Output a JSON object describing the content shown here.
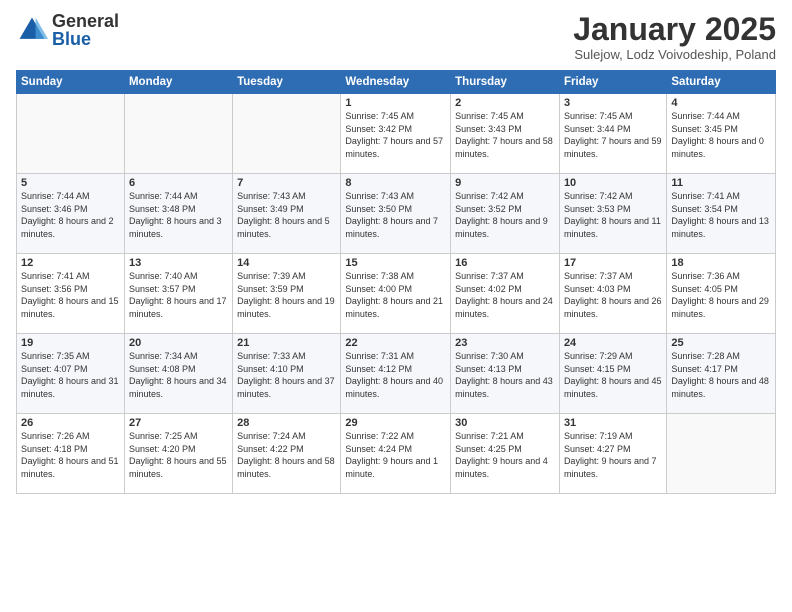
{
  "header": {
    "logo_general": "General",
    "logo_blue": "Blue",
    "month_title": "January 2025",
    "subtitle": "Sulejow, Lodz Voivodeship, Poland"
  },
  "weekdays": [
    "Sunday",
    "Monday",
    "Tuesday",
    "Wednesday",
    "Thursday",
    "Friday",
    "Saturday"
  ],
  "weeks": [
    [
      {
        "day": "",
        "info": ""
      },
      {
        "day": "",
        "info": ""
      },
      {
        "day": "",
        "info": ""
      },
      {
        "day": "1",
        "info": "Sunrise: 7:45 AM\nSunset: 3:42 PM\nDaylight: 7 hours and 57 minutes."
      },
      {
        "day": "2",
        "info": "Sunrise: 7:45 AM\nSunset: 3:43 PM\nDaylight: 7 hours and 58 minutes."
      },
      {
        "day": "3",
        "info": "Sunrise: 7:45 AM\nSunset: 3:44 PM\nDaylight: 7 hours and 59 minutes."
      },
      {
        "day": "4",
        "info": "Sunrise: 7:44 AM\nSunset: 3:45 PM\nDaylight: 8 hours and 0 minutes."
      }
    ],
    [
      {
        "day": "5",
        "info": "Sunrise: 7:44 AM\nSunset: 3:46 PM\nDaylight: 8 hours and 2 minutes."
      },
      {
        "day": "6",
        "info": "Sunrise: 7:44 AM\nSunset: 3:48 PM\nDaylight: 8 hours and 3 minutes."
      },
      {
        "day": "7",
        "info": "Sunrise: 7:43 AM\nSunset: 3:49 PM\nDaylight: 8 hours and 5 minutes."
      },
      {
        "day": "8",
        "info": "Sunrise: 7:43 AM\nSunset: 3:50 PM\nDaylight: 8 hours and 7 minutes."
      },
      {
        "day": "9",
        "info": "Sunrise: 7:42 AM\nSunset: 3:52 PM\nDaylight: 8 hours and 9 minutes."
      },
      {
        "day": "10",
        "info": "Sunrise: 7:42 AM\nSunset: 3:53 PM\nDaylight: 8 hours and 11 minutes."
      },
      {
        "day": "11",
        "info": "Sunrise: 7:41 AM\nSunset: 3:54 PM\nDaylight: 8 hours and 13 minutes."
      }
    ],
    [
      {
        "day": "12",
        "info": "Sunrise: 7:41 AM\nSunset: 3:56 PM\nDaylight: 8 hours and 15 minutes."
      },
      {
        "day": "13",
        "info": "Sunrise: 7:40 AM\nSunset: 3:57 PM\nDaylight: 8 hours and 17 minutes."
      },
      {
        "day": "14",
        "info": "Sunrise: 7:39 AM\nSunset: 3:59 PM\nDaylight: 8 hours and 19 minutes."
      },
      {
        "day": "15",
        "info": "Sunrise: 7:38 AM\nSunset: 4:00 PM\nDaylight: 8 hours and 21 minutes."
      },
      {
        "day": "16",
        "info": "Sunrise: 7:37 AM\nSunset: 4:02 PM\nDaylight: 8 hours and 24 minutes."
      },
      {
        "day": "17",
        "info": "Sunrise: 7:37 AM\nSunset: 4:03 PM\nDaylight: 8 hours and 26 minutes."
      },
      {
        "day": "18",
        "info": "Sunrise: 7:36 AM\nSunset: 4:05 PM\nDaylight: 8 hours and 29 minutes."
      }
    ],
    [
      {
        "day": "19",
        "info": "Sunrise: 7:35 AM\nSunset: 4:07 PM\nDaylight: 8 hours and 31 minutes."
      },
      {
        "day": "20",
        "info": "Sunrise: 7:34 AM\nSunset: 4:08 PM\nDaylight: 8 hours and 34 minutes."
      },
      {
        "day": "21",
        "info": "Sunrise: 7:33 AM\nSunset: 4:10 PM\nDaylight: 8 hours and 37 minutes."
      },
      {
        "day": "22",
        "info": "Sunrise: 7:31 AM\nSunset: 4:12 PM\nDaylight: 8 hours and 40 minutes."
      },
      {
        "day": "23",
        "info": "Sunrise: 7:30 AM\nSunset: 4:13 PM\nDaylight: 8 hours and 43 minutes."
      },
      {
        "day": "24",
        "info": "Sunrise: 7:29 AM\nSunset: 4:15 PM\nDaylight: 8 hours and 45 minutes."
      },
      {
        "day": "25",
        "info": "Sunrise: 7:28 AM\nSunset: 4:17 PM\nDaylight: 8 hours and 48 minutes."
      }
    ],
    [
      {
        "day": "26",
        "info": "Sunrise: 7:26 AM\nSunset: 4:18 PM\nDaylight: 8 hours and 51 minutes."
      },
      {
        "day": "27",
        "info": "Sunrise: 7:25 AM\nSunset: 4:20 PM\nDaylight: 8 hours and 55 minutes."
      },
      {
        "day": "28",
        "info": "Sunrise: 7:24 AM\nSunset: 4:22 PM\nDaylight: 8 hours and 58 minutes."
      },
      {
        "day": "29",
        "info": "Sunrise: 7:22 AM\nSunset: 4:24 PM\nDaylight: 9 hours and 1 minute."
      },
      {
        "day": "30",
        "info": "Sunrise: 7:21 AM\nSunset: 4:25 PM\nDaylight: 9 hours and 4 minutes."
      },
      {
        "day": "31",
        "info": "Sunrise: 7:19 AM\nSunset: 4:27 PM\nDaylight: 9 hours and 7 minutes."
      },
      {
        "day": "",
        "info": ""
      }
    ]
  ]
}
